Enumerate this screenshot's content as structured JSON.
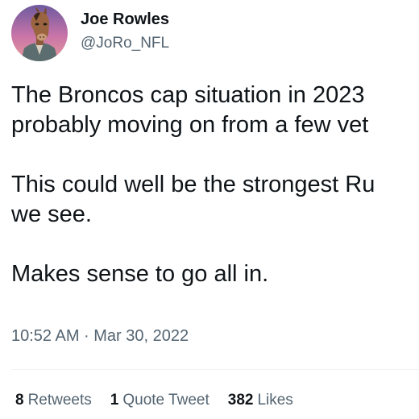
{
  "author": {
    "name": "Joe Rowles",
    "handle": "@JoRo_NFL",
    "avatar_icon": "horse-head-avatar"
  },
  "tweet": {
    "paragraphs": [
      [
        "The Broncos cap situation in 2023",
        "probably moving on from a few vet"
      ],
      [
        "This could well be the strongest Ru",
        "we see."
      ],
      [
        "Makes sense to go all in."
      ]
    ],
    "timestamp": "10:52 AM · Mar 30, 2022"
  },
  "stats": {
    "retweets": {
      "count": "8",
      "label": "Retweets"
    },
    "quotes": {
      "count": "1",
      "label": "Quote Tweet"
    },
    "likes": {
      "count": "382",
      "label": "Likes"
    }
  },
  "colors": {
    "text_primary": "#0f1419",
    "text_secondary": "#536471",
    "divider": "#eff3f4"
  }
}
